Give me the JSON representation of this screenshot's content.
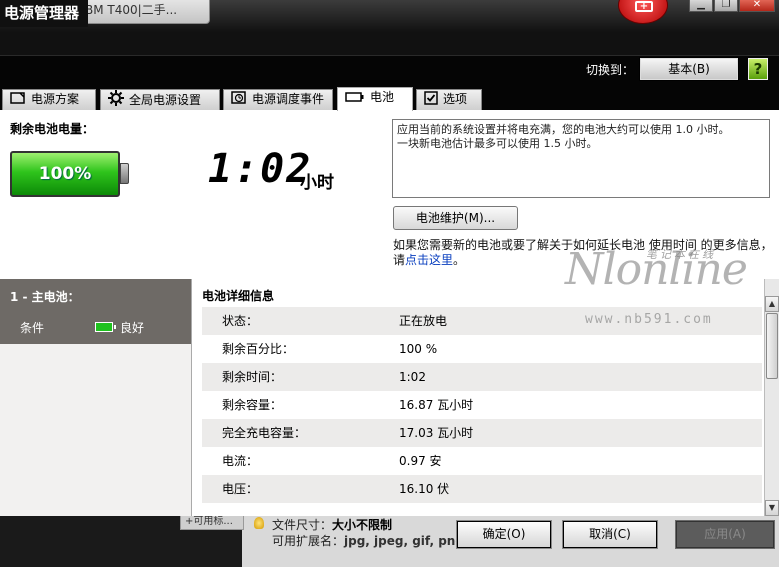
{
  "window": {
    "title": "电源管理器",
    "bg_tab_text": "BM T400|二手..."
  },
  "header": {
    "switch_label": "切换到：",
    "basic_button": "基本(B)",
    "help_icon": "?"
  },
  "tabs": [
    {
      "label": "电源方案",
      "icon": "plan-icon"
    },
    {
      "label": "全局电源设置",
      "icon": "gear-icon"
    },
    {
      "label": "电源调度事件",
      "icon": "clock-icon"
    },
    {
      "label": "电池",
      "icon": "battery-icon",
      "active": true
    },
    {
      "label": "选项",
      "icon": "checkbox-icon"
    }
  ],
  "battery_panel": {
    "remaining_label": "剩余电池电量：",
    "percent_text": "100%",
    "time": "1:02",
    "time_unit": "小时",
    "info_line1": "应用当前的系统设置并将电充满，您的电池大约可以使用 1.0 小时。",
    "info_line2": "一块新电池估计最多可以使用 1.5 小时。",
    "maintenance_button": "电池维护(M)...",
    "more_info_text": "如果您需要新的电池或要了解关于如何延长电池 使用时间 的更多信息，请",
    "more_info_link": "点击这里",
    "more_info_end": "。"
  },
  "battery_list": {
    "title": "1 - 主电池：",
    "condition_label": "条件",
    "condition_value": "良好"
  },
  "details": {
    "title": "电池详细信息",
    "rows": [
      {
        "key": "状态：",
        "value": "正在放电"
      },
      {
        "key": "剩余百分比：",
        "value": "100 %"
      },
      {
        "key": "剩余时间：",
        "value": "1:02"
      },
      {
        "key": "剩余容量：",
        "value": "16.87 瓦小时"
      },
      {
        "key": "完全充电容量：",
        "value": "17.03 瓦小时"
      },
      {
        "key": "电流：",
        "value": "0.97 安"
      },
      {
        "key": "电压：",
        "value": "16.10 伏"
      },
      {
        "key": "...",
        "value": "..."
      }
    ]
  },
  "watermark": {
    "logo": "Nlonline",
    "cn": "笔记本在线",
    "url": "www.nb591.com"
  },
  "footer": {
    "behind_tab": "+可用标...",
    "file_size_label": "文件尺寸：",
    "file_size_value": "大小不限制",
    "ext_label": "可用扩展名：",
    "ext_value": "jpg, jpeg, gif, png",
    "ok_button": "确定(O)",
    "cancel_button": "取消(C)",
    "apply_button": "应用(A)"
  },
  "colors": {
    "battery_green": "#2fc41c",
    "link_blue": "#0a3fbf",
    "left_header": "#6e6a66"
  }
}
